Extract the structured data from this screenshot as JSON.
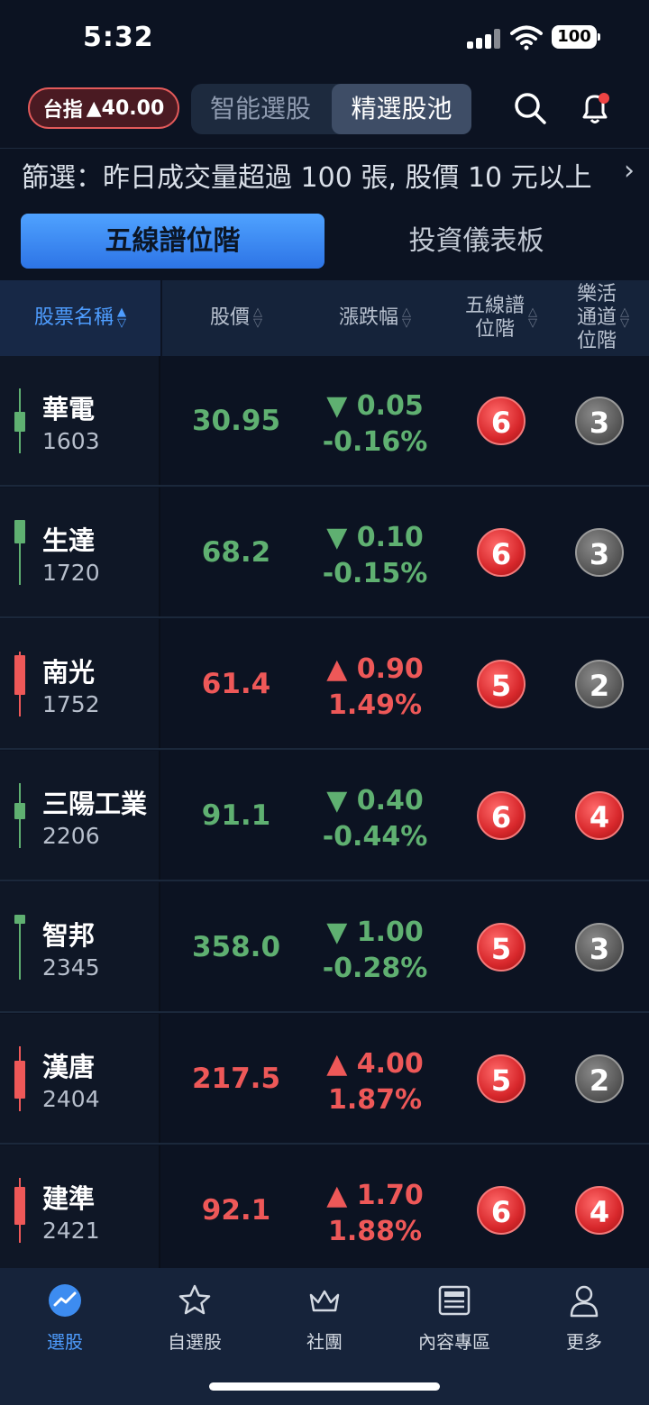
{
  "status": {
    "time": "5:32",
    "battery": "100"
  },
  "header": {
    "index_label": "台指",
    "index_change": "▲40.00",
    "seg_tabs": [
      "智能選股",
      "精選股池"
    ],
    "icons": [
      "search-icon",
      "bell-icon"
    ]
  },
  "filter": {
    "text": "篩選：昨日成交量超過 100 張, 股價 10 元以上"
  },
  "tabs": [
    "五線譜位階",
    "投資儀表板"
  ],
  "columns": {
    "name": "股票名稱",
    "price": "股價",
    "change": "漲跌幅",
    "five_line": "五線譜\n位階",
    "lehuo": "樂活\n通道\n位階"
  },
  "stocks": [
    {
      "name": "華電",
      "code": "1603",
      "price": "30.95",
      "change": "▼ 0.05",
      "pct": "-0.16%",
      "dir": "down",
      "five": "6",
      "lehuo": "3",
      "five_color": "red",
      "lehuo_color": "gray"
    },
    {
      "name": "生達",
      "code": "1720",
      "price": "68.2",
      "change": "▼ 0.10",
      "pct": "-0.15%",
      "dir": "down",
      "five": "6",
      "lehuo": "3",
      "five_color": "red",
      "lehuo_color": "gray"
    },
    {
      "name": "南光",
      "code": "1752",
      "price": "61.4",
      "change": "▲ 0.90",
      "pct": "1.49%",
      "dir": "up",
      "five": "5",
      "lehuo": "2",
      "five_color": "red",
      "lehuo_color": "gray"
    },
    {
      "name": "三陽工業",
      "code": "2206",
      "price": "91.1",
      "change": "▼ 0.40",
      "pct": "-0.44%",
      "dir": "down",
      "five": "6",
      "lehuo": "4",
      "five_color": "red",
      "lehuo_color": "red"
    },
    {
      "name": "智邦",
      "code": "2345",
      "price": "358.0",
      "change": "▼ 1.00",
      "pct": "-0.28%",
      "dir": "down",
      "five": "5",
      "lehuo": "3",
      "five_color": "red",
      "lehuo_color": "gray"
    },
    {
      "name": "漢唐",
      "code": "2404",
      "price": "217.5",
      "change": "▲ 4.00",
      "pct": "1.87%",
      "dir": "up",
      "five": "5",
      "lehuo": "2",
      "five_color": "red",
      "lehuo_color": "gray"
    },
    {
      "name": "建準",
      "code": "2421",
      "price": "92.1",
      "change": "▲ 1.70",
      "pct": "1.88%",
      "dir": "up",
      "five": "6",
      "lehuo": "4",
      "five_color": "red",
      "lehuo_color": "red"
    }
  ],
  "nav": [
    {
      "label": "選股",
      "icon": "chart-icon",
      "active": true
    },
    {
      "label": "自選股",
      "icon": "star-icon"
    },
    {
      "label": "社團",
      "icon": "crown-icon"
    },
    {
      "label": "內容專區",
      "icon": "newspaper-icon"
    },
    {
      "label": "更多",
      "icon": "user-icon"
    }
  ],
  "colors": {
    "up": "#ee5858",
    "down": "#5fb071",
    "accent": "#4e9dff",
    "bg": "#0c1322"
  }
}
